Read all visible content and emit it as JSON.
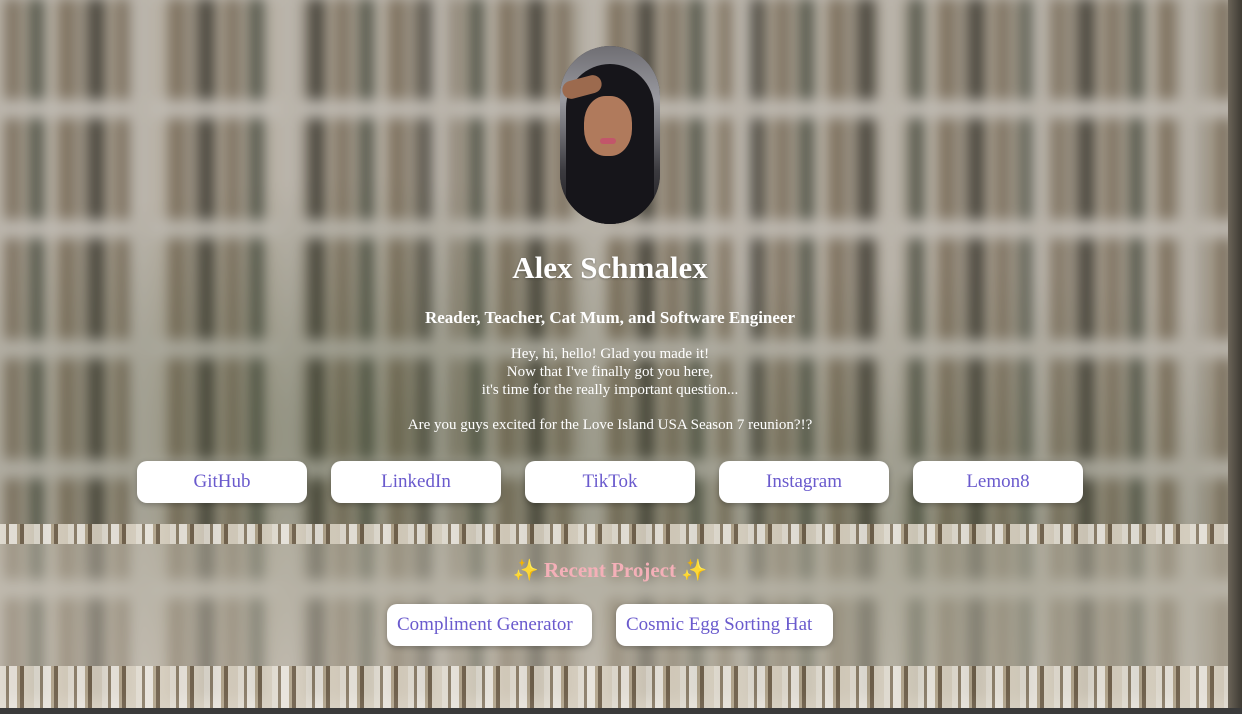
{
  "profile": {
    "name": "Alex Schmalex",
    "tagline": "Reader, Teacher, Cat Mum, and Software Engineer",
    "intro_lines": [
      "Hey, hi, hello! Glad you made it!",
      "Now that I've finally got you here,",
      "it's time for the really important question..."
    ],
    "question": "Are you guys excited for the Love Island USA Season 7 reunion?!?"
  },
  "social_links": [
    {
      "label": "GitHub"
    },
    {
      "label": "LinkedIn"
    },
    {
      "label": "TikTok"
    },
    {
      "label": "Instagram"
    },
    {
      "label": "Lemon8"
    }
  ],
  "projects": {
    "title": "Recent Project",
    "sparkle": "✨",
    "items": [
      {
        "label": "Compliment Generator"
      },
      {
        "label": "Cosmic Egg Sorting Hat"
      }
    ]
  },
  "colors": {
    "link_text": "#6a5acd",
    "projects_title": "#f4b0b8",
    "sparkle": "#f3c04a"
  }
}
